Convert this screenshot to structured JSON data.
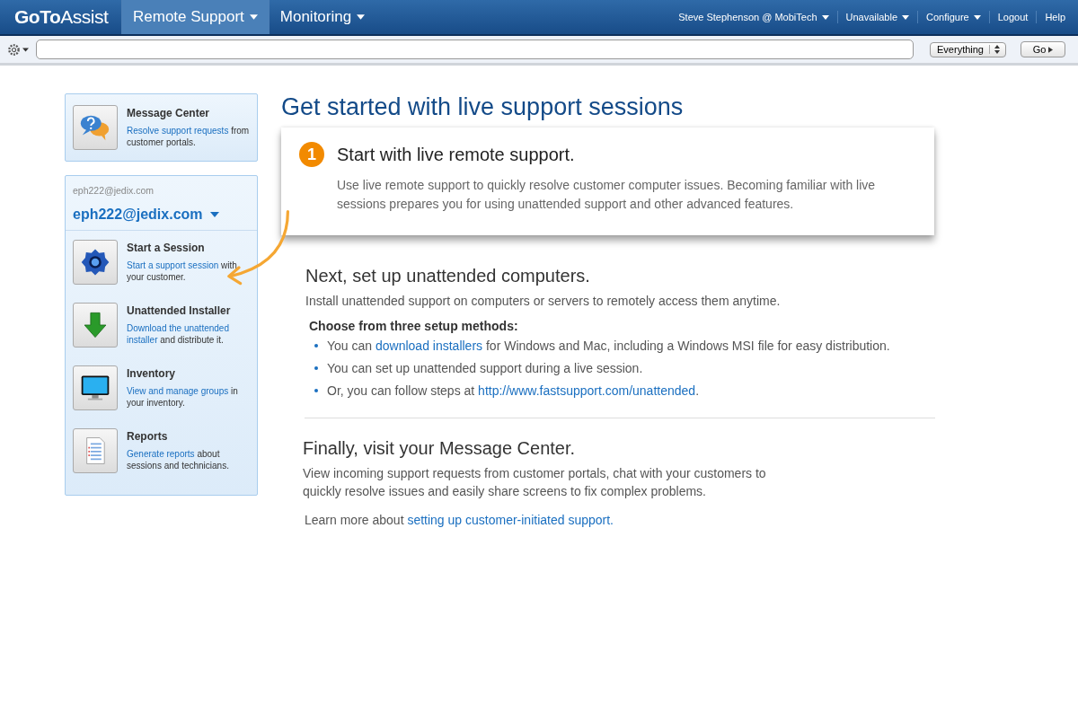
{
  "topbar": {
    "logo": {
      "bold": "GoTo",
      "light": "Assist"
    },
    "nav": [
      {
        "label": "Remote Support",
        "selected": true
      },
      {
        "label": "Monitoring",
        "selected": false
      }
    ],
    "user_menu": [
      {
        "label": "Steve Stephenson @ MobiTech",
        "dropdown": true
      },
      {
        "label": "Unavailable",
        "dropdown": true
      },
      {
        "label": "Configure",
        "dropdown": true
      },
      {
        "label": "Logout",
        "dropdown": false
      },
      {
        "label": "Help",
        "dropdown": false
      }
    ]
  },
  "toolbar": {
    "scope": "Everything",
    "go": "Go"
  },
  "sidebar": {
    "message_center": {
      "kind": "chat",
      "title": "Message Center",
      "links": [
        "Resolve support requests"
      ],
      "rest": "from customer portals."
    },
    "account_caption": "eph222@jedix.com",
    "account": "eph222@jedix.com",
    "items": [
      {
        "kind": "gear",
        "title": "Start a Session",
        "links": [
          "Start a support session"
        ],
        "rest": "with your customer."
      },
      {
        "kind": "download",
        "title": "Unattended Installer",
        "links": [
          "Download the unattended",
          "installer"
        ],
        "rest": "and distribute it."
      },
      {
        "kind": "monitor",
        "title": "Inventory",
        "links": [
          "View and manage groups"
        ],
        "rest": "in your inventory."
      },
      {
        "kind": "report",
        "title": "Reports",
        "links": [
          "Generate reports"
        ],
        "rest": "about sessions and technicians."
      }
    ]
  },
  "main": {
    "title": "Get started with live support sessions",
    "step": {
      "number": "1",
      "heading": "Start with live remote support.",
      "text": "Use live remote support to quickly resolve customer computer issues. Becoming familiar with live sessions prepares you for using unattended support and other advanced features."
    },
    "unattended": {
      "heading": "Next, set up unattended computers.",
      "text": "Install unattended support on computers or servers to remotely access them anytime.",
      "subheading": "Choose from three setup methods:",
      "bullets": [
        {
          "before": "You can ",
          "link": "download installers",
          "after": " for Windows and Mac, including a Windows MSI file for easy distribution."
        },
        {
          "before": "You can set up unattended support during a live session."
        },
        {
          "before": "Or, you can follow steps at ",
          "link": "http://www.fastsupport.com/unattended",
          "after": "."
        }
      ]
    },
    "message_center": {
      "heading": "Finally, visit your Message Center.",
      "text": "View incoming support requests from customer portals, chat with your customers to quickly resolve issues and easily share screens to fix complex problems.",
      "learn_before": "Learn more about ",
      "learn_link": "setting up customer-initiated support."
    }
  }
}
